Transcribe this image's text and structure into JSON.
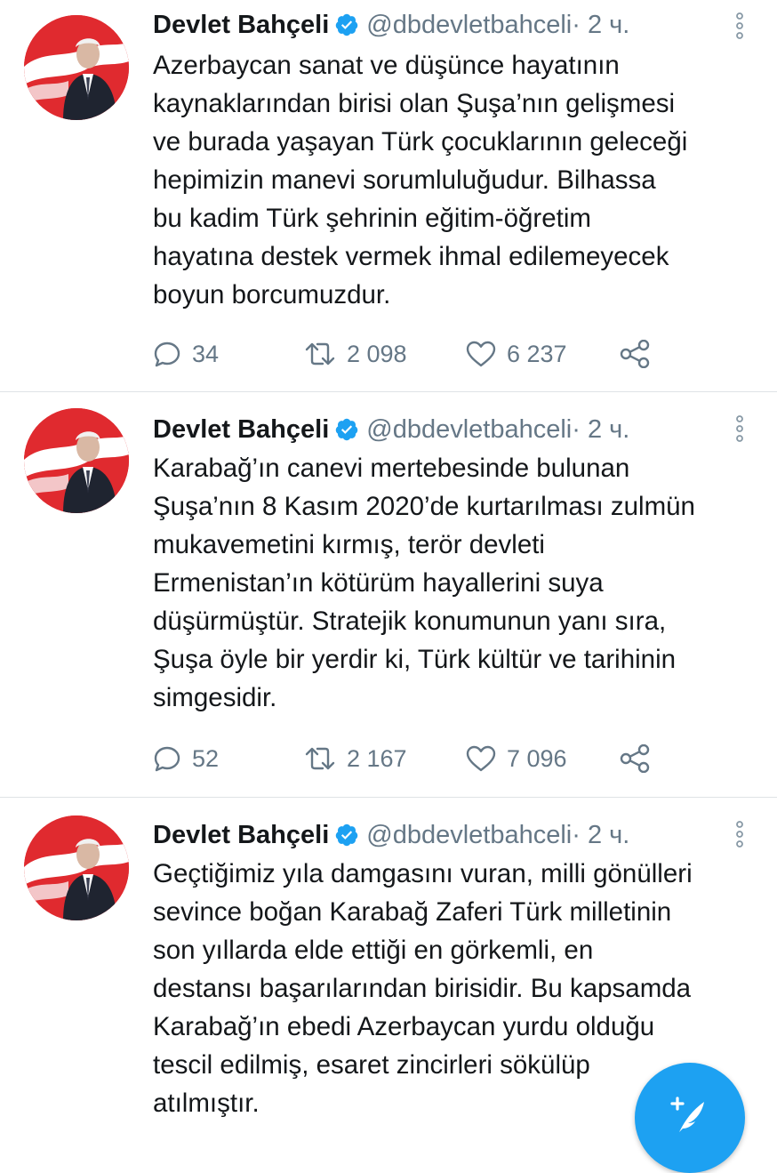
{
  "colors": {
    "accent": "#1da1f2",
    "secondary_text": "#657786",
    "primary_text": "#14171a"
  },
  "tweets": [
    {
      "author_name": "Devlet Bahçeli",
      "handle": "@dbdevletbahceli",
      "meta": " · 2 ч.",
      "text": "Azerbaycan sanat ve düşünce hayatının\nkaynaklarından birisi olan Şuşa’nın gelişmesi\nve burada yaşayan Türk çocuklarının geleceği\nhepimizin manevi sorumluluğudur. Bilhassa\nbu kadim Türk şehrinin eğitim-öğretim\nhayatına destek vermek ihmal edilemeyecek\nboyun borcumuzdur.",
      "replies": "34",
      "retweets": "2 098",
      "likes": "6 237"
    },
    {
      "author_name": "Devlet Bahçeli",
      "handle": "@dbdevletbahceli",
      "meta": " · 2 ч.",
      "text": "Karabağ’ın canevi mertebesinde bulunan\nŞuşa’nın 8 Kasım 2020’de kurtarılması zulmün\nmukavemetini kırmış, terör devleti\nErmenistan’ın kötürüm hayallerini suya\ndüşürmüştür. Stratejik konumunun yanı sıra,\nŞuşa öyle bir yerdir ki, Türk kültür ve tarihinin\nsimgesidir.",
      "replies": "52",
      "retweets": "2 167",
      "likes": "7 096"
    },
    {
      "author_name": "Devlet Bahçeli",
      "handle": "@dbdevletbahceli",
      "meta": " · 2 ч.",
      "text": "Geçtiğimiz yıla damgasını vuran, milli gönülleri\nsevince boğan Karabağ Zaferi Türk milletinin\nson yıllarda elde ettiği en görkemli, en\ndestansı başarılarından birisidir. Bu kapsamda\nKarabağ’ın ebedi Azerbaycan yurdu olduğu\ntescil edilmiş, esaret zincirleri sökülüp\natılmıştır."
    }
  ],
  "icons": {
    "reply": "reply-icon",
    "retweet": "retweet-icon",
    "like": "heart-icon",
    "share": "share-icon",
    "verified": "verified-badge-icon",
    "more": "more-vertical-icon",
    "compose": "compose-tweet-icon"
  }
}
